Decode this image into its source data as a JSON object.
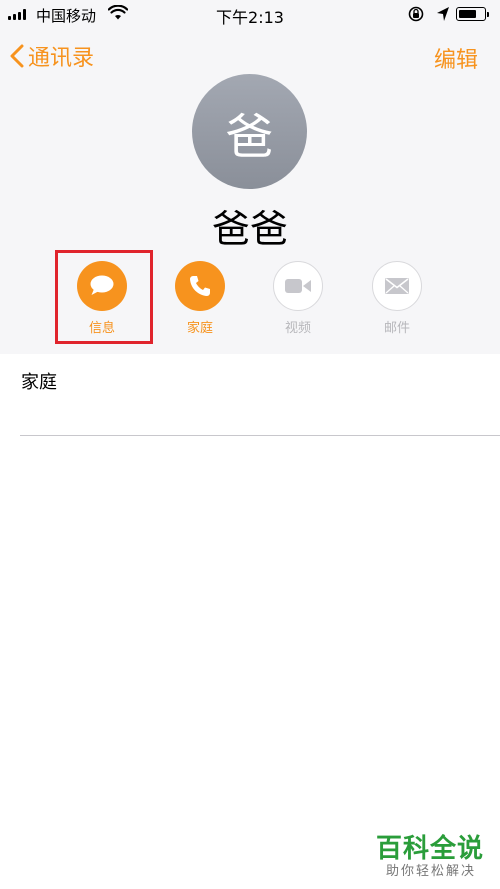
{
  "status_bar": {
    "carrier": "中国移动",
    "time": "下午2:13",
    "battery_level": 0.7
  },
  "nav": {
    "back_label": "通讯录",
    "edit_label": "编辑"
  },
  "contact": {
    "avatar_initial": "爸",
    "name": "爸爸"
  },
  "actions": [
    {
      "label": "信息",
      "icon": "message-bubble-icon",
      "enabled": true
    },
    {
      "label": "家庭",
      "icon": "phone-icon",
      "enabled": true
    },
    {
      "label": "视频",
      "icon": "video-camera-icon",
      "enabled": false
    },
    {
      "label": "邮件",
      "icon": "mail-icon",
      "enabled": false
    }
  ],
  "details": {
    "phone_label": "家庭"
  },
  "watermark": {
    "title": "百科全说",
    "subtitle": "助你轻松解决"
  },
  "colors": {
    "accent": "#f7931e",
    "highlight": "#e0242c",
    "avatar": "#9a9fa8",
    "watermark": "#2a9d3a"
  }
}
